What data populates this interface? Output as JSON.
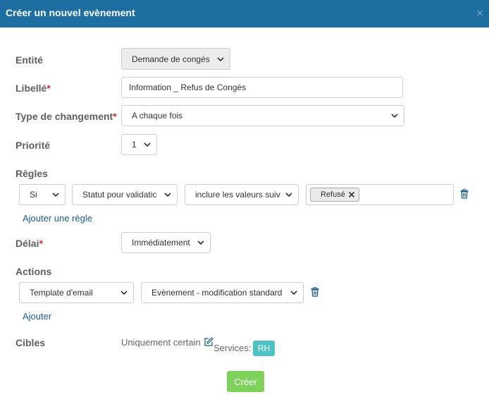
{
  "header": {
    "title": "Créer un nouvel evènement",
    "close_glyph": "×"
  },
  "form": {
    "entity": {
      "label": "Entité",
      "value": "Demande de congés"
    },
    "libelle": {
      "label": "Libellé",
      "value": "Information _ Refus de Congés"
    },
    "change_type": {
      "label": "Type de changement",
      "value": "A chaque fois"
    },
    "priority": {
      "label": "Priorité",
      "value": "1"
    },
    "rules": {
      "label": "Règles",
      "condition": "Si",
      "field": "Statut pour validatic",
      "operator": "inclure les valeurs suiv",
      "tags": [
        "Refusé"
      ],
      "add_link": "Ajouter une règle"
    },
    "delay": {
      "label": "Délai",
      "value": "Immédiatement"
    },
    "actions": {
      "label": "Actions",
      "type": "Template d'email",
      "template": "Evènement - modification standard",
      "add_link": "Ajouter"
    },
    "targets": {
      "label": "Cibles",
      "mode": "Uniquement certain",
      "services_label": "Services:",
      "services": [
        "RH"
      ]
    },
    "required_mark": "*",
    "submit_label": "Créer"
  },
  "colors": {
    "header_bg": "#1c6fa0",
    "required": "#c9302c",
    "link": "#1f5e89",
    "submit": "#7ed15a",
    "badge": "#4fc3c3"
  }
}
